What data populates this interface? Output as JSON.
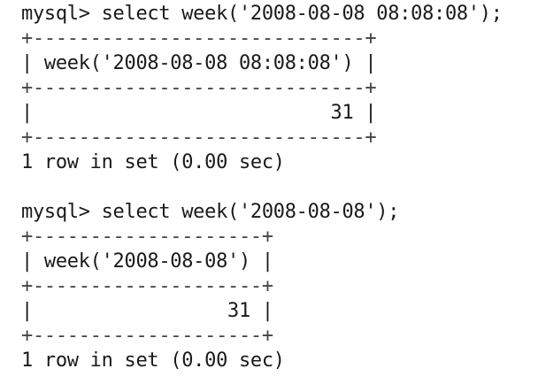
{
  "terminal": {
    "blocks": [
      {
        "command": "mysql> select week('2008-08-08 08:08:08');",
        "border": "+-----------------------------+",
        "header": "| week('2008-08-08 08:08:08') |",
        "row": "|                          31 |",
        "status": "1 row in set (0.00 sec)"
      },
      {
        "command": "mysql> select week('2008-08-08');",
        "border": "+--------------------+",
        "header": "| week('2008-08-08') |",
        "row": "|                 31 |",
        "status": "1 row in set (0.00 sec)"
      }
    ]
  }
}
